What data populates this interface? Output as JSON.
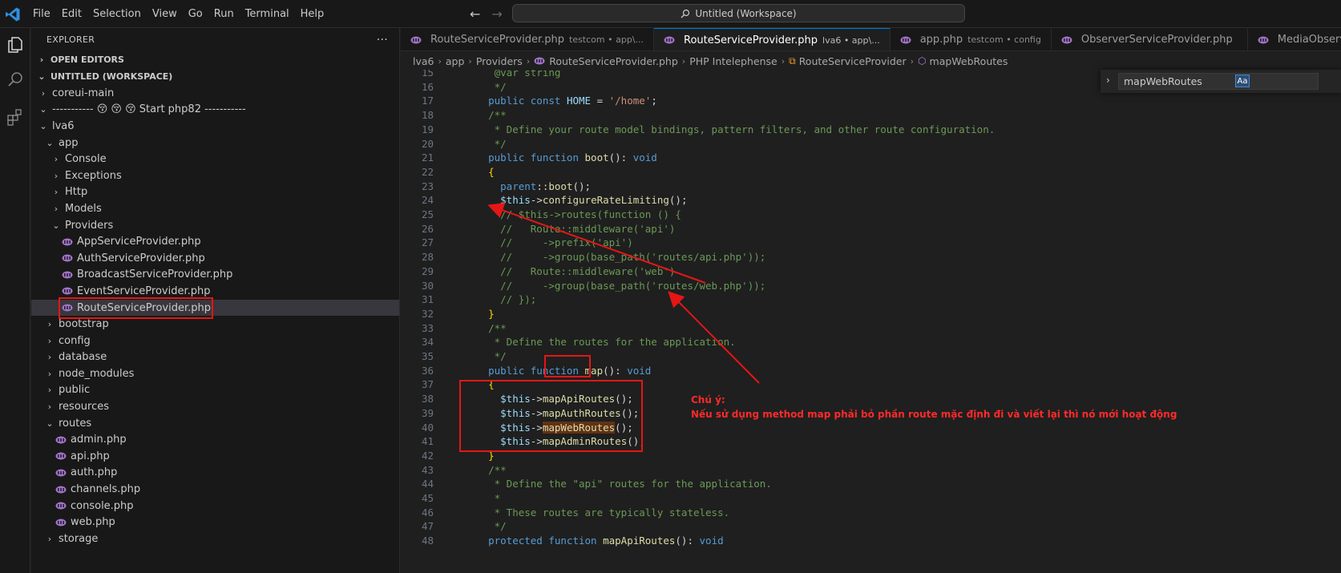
{
  "menu": [
    "File",
    "Edit",
    "Selection",
    "View",
    "Go",
    "Run",
    "Terminal",
    "Help"
  ],
  "command_center": {
    "label": "Untitled (Workspace)"
  },
  "explorer": {
    "title": "EXPLORER",
    "more": "···",
    "open_editors": "OPEN EDITORS",
    "workspace": "UNTITLED (WORKSPACE)",
    "tree": [
      {
        "label": "coreui-main",
        "type": "folder",
        "level": 0,
        "expanded": false
      },
      {
        "label": "----------- 😚 😚 😚 Start php82 -----------",
        "type": "folder",
        "level": 0,
        "expanded": true
      },
      {
        "label": "lva6",
        "type": "folder",
        "level": 0,
        "expanded": true
      },
      {
        "label": "app",
        "type": "folder",
        "level": 1,
        "expanded": true
      },
      {
        "label": "Console",
        "type": "folder",
        "level": 2,
        "expanded": false
      },
      {
        "label": "Exceptions",
        "type": "folder",
        "level": 2,
        "expanded": false
      },
      {
        "label": "Http",
        "type": "folder",
        "level": 2,
        "expanded": false
      },
      {
        "label": "Models",
        "type": "folder",
        "level": 2,
        "expanded": false
      },
      {
        "label": "Providers",
        "type": "folder",
        "level": 2,
        "expanded": true
      },
      {
        "label": "AppServiceProvider.php",
        "type": "php",
        "level": 3
      },
      {
        "label": "AuthServiceProvider.php",
        "type": "php",
        "level": 3
      },
      {
        "label": "BroadcastServiceProvider.php",
        "type": "php",
        "level": 3
      },
      {
        "label": "EventServiceProvider.php",
        "type": "php",
        "level": 3
      },
      {
        "label": "RouteServiceProvider.php",
        "type": "php",
        "level": 3,
        "selected": true
      },
      {
        "label": "bootstrap",
        "type": "folder",
        "level": 1,
        "expanded": false
      },
      {
        "label": "config",
        "type": "folder",
        "level": 1,
        "expanded": false
      },
      {
        "label": "database",
        "type": "folder",
        "level": 1,
        "expanded": false
      },
      {
        "label": "node_modules",
        "type": "folder",
        "level": 1,
        "expanded": false
      },
      {
        "label": "public",
        "type": "folder",
        "level": 1,
        "expanded": false
      },
      {
        "label": "resources",
        "type": "folder",
        "level": 1,
        "expanded": false
      },
      {
        "label": "routes",
        "type": "folder",
        "level": 1,
        "expanded": true
      },
      {
        "label": "admin.php",
        "type": "php",
        "level": 2
      },
      {
        "label": "api.php",
        "type": "php",
        "level": 2
      },
      {
        "label": "auth.php",
        "type": "php",
        "level": 2
      },
      {
        "label": "channels.php",
        "type": "php",
        "level": 2
      },
      {
        "label": "console.php",
        "type": "php",
        "level": 2
      },
      {
        "label": "web.php",
        "type": "php",
        "level": 2
      },
      {
        "label": "storage",
        "type": "folder",
        "level": 1,
        "expanded": false
      }
    ]
  },
  "tabs": [
    {
      "name": "RouteServiceProvider.php",
      "desc": "testcom • app\\...",
      "active": false
    },
    {
      "name": "RouteServiceProvider.php",
      "desc": "lva6 • app\\...",
      "active": true
    },
    {
      "name": "app.php",
      "desc": "testcom • config",
      "active": false
    },
    {
      "name": "ObserverServiceProvider.php",
      "desc": "",
      "active": false
    },
    {
      "name": "MediaObserver.php",
      "desc": "",
      "active": false
    }
  ],
  "breadcrumb": [
    "lva6",
    "app",
    "Providers",
    "RouteServiceProvider.php",
    "PHP Intelephense",
    "RouteServiceProvider",
    "mapWebRoutes"
  ],
  "find": {
    "value": "mapWebRoutes",
    "match_case": "Aa"
  },
  "code": [
    {
      "n": "15",
      "t": [
        [
          "     @var string",
          "cm"
        ]
      ]
    },
    {
      "n": "16",
      "t": [
        [
          "     */",
          "cm"
        ]
      ]
    },
    {
      "n": "17",
      "t": [
        [
          "    public const ",
          "kw"
        ],
        [
          "HOME",
          "vr"
        ],
        [
          " = ",
          "op"
        ],
        [
          "'/home'",
          "st"
        ],
        [
          ";",
          "op"
        ]
      ]
    },
    {
      "n": "18",
      "t": [
        [
          "    /**",
          "cm"
        ]
      ]
    },
    {
      "n": "19",
      "t": [
        [
          "     * Define your route model bindings, pattern filters, and other route configuration.",
          "cm"
        ]
      ]
    },
    {
      "n": "20",
      "t": [
        [
          "     */",
          "cm"
        ]
      ]
    },
    {
      "n": "21",
      "t": [
        [
          "    public function ",
          "kw"
        ],
        [
          "boot",
          "fn"
        ],
        [
          "(): ",
          "op"
        ],
        [
          "void",
          "kw"
        ]
      ]
    },
    {
      "n": "22",
      "t": [
        [
          "    {",
          "br"
        ]
      ]
    },
    {
      "n": "23",
      "t": [
        [
          "      parent",
          "kw"
        ],
        [
          "::",
          "op"
        ],
        [
          "boot",
          "fn"
        ],
        [
          "();",
          "op"
        ]
      ]
    },
    {
      "n": "24",
      "t": [
        [
          "      $this",
          "vr"
        ],
        [
          "->",
          "op"
        ],
        [
          "configureRateLimiting",
          "fn"
        ],
        [
          "();",
          "op"
        ]
      ]
    },
    {
      "n": "25",
      "t": [
        [
          "      // $this->routes(function () {",
          "cm"
        ]
      ]
    },
    {
      "n": "26",
      "t": [
        [
          "      //   Route::middleware('api')",
          "cm"
        ]
      ]
    },
    {
      "n": "27",
      "t": [
        [
          "      //     ->prefix('api')",
          "cm"
        ]
      ]
    },
    {
      "n": "28",
      "t": [
        [
          "      //     ->group(base_path('routes/api.php'));",
          "cm"
        ]
      ]
    },
    {
      "n": "29",
      "t": [
        [
          "      //   Route::middleware('web')",
          "cm"
        ]
      ]
    },
    {
      "n": "30",
      "t": [
        [
          "      //     ->group(base_path('routes/web.php'));",
          "cm"
        ]
      ]
    },
    {
      "n": "31",
      "t": [
        [
          "      // });",
          "cm"
        ]
      ]
    },
    {
      "n": "32",
      "t": [
        [
          "    }",
          "br"
        ]
      ]
    },
    {
      "n": "33",
      "t": [
        [
          "    /**",
          "cm"
        ]
      ]
    },
    {
      "n": "34",
      "t": [
        [
          "     * Define the routes for the application.",
          "cm"
        ]
      ]
    },
    {
      "n": "35",
      "t": [
        [
          "     */",
          "cm"
        ]
      ]
    },
    {
      "n": "36",
      "t": [
        [
          "    public function ",
          "kw"
        ],
        [
          "map",
          "fn"
        ],
        [
          "(): ",
          "op"
        ],
        [
          "void",
          "kw"
        ]
      ]
    },
    {
      "n": "37",
      "t": [
        [
          "    {",
          "br"
        ]
      ]
    },
    {
      "n": "38",
      "t": [
        [
          "      $this",
          "vr"
        ],
        [
          "->",
          "op"
        ],
        [
          "mapApiRoutes",
          "fn"
        ],
        [
          "();",
          "op"
        ]
      ]
    },
    {
      "n": "39",
      "t": [
        [
          "      $this",
          "vr"
        ],
        [
          "->",
          "op"
        ],
        [
          "mapAuthRoutes",
          "fn"
        ],
        [
          "();",
          "op"
        ]
      ]
    },
    {
      "n": "40",
      "t": [
        [
          "      $this",
          "vr"
        ],
        [
          "->",
          "op"
        ],
        [
          "mapWebRoutes",
          "fn"
        ],
        [
          "();",
          "op"
        ]
      ]
    },
    {
      "n": "41",
      "t": [
        [
          "      $this",
          "vr"
        ],
        [
          "->",
          "op"
        ],
        [
          "mapAdminRoutes",
          "fn"
        ],
        [
          "();",
          "op"
        ]
      ]
    },
    {
      "n": "42",
      "t": [
        [
          "    }",
          "br"
        ]
      ]
    },
    {
      "n": "43",
      "t": [
        [
          "    /**",
          "cm"
        ]
      ]
    },
    {
      "n": "44",
      "t": [
        [
          "     * Define the \"api\" routes for the application.",
          "cm"
        ]
      ]
    },
    {
      "n": "45",
      "t": [
        [
          "     *",
          "cm"
        ]
      ]
    },
    {
      "n": "46",
      "t": [
        [
          "     * These routes are typically stateless.",
          "cm"
        ]
      ]
    },
    {
      "n": "47",
      "t": [
        [
          "     */",
          "cm"
        ]
      ]
    },
    {
      "n": "48",
      "t": [
        [
          "    protected function ",
          "kw"
        ],
        [
          "mapApiRoutes",
          "fn"
        ],
        [
          "(): ",
          "op"
        ],
        [
          "void",
          "kw"
        ]
      ]
    }
  ],
  "annotation": {
    "title": "Chú ý:",
    "body": "Nếu sử dụng method map phải bỏ phần route mặc định đi và viết lại thì nó mới hoạt động",
    "color": "#ff2a2a"
  },
  "colors": {
    "accent": "#0078d4",
    "php_icon": "#a074c4",
    "annotation": "#e51616"
  }
}
